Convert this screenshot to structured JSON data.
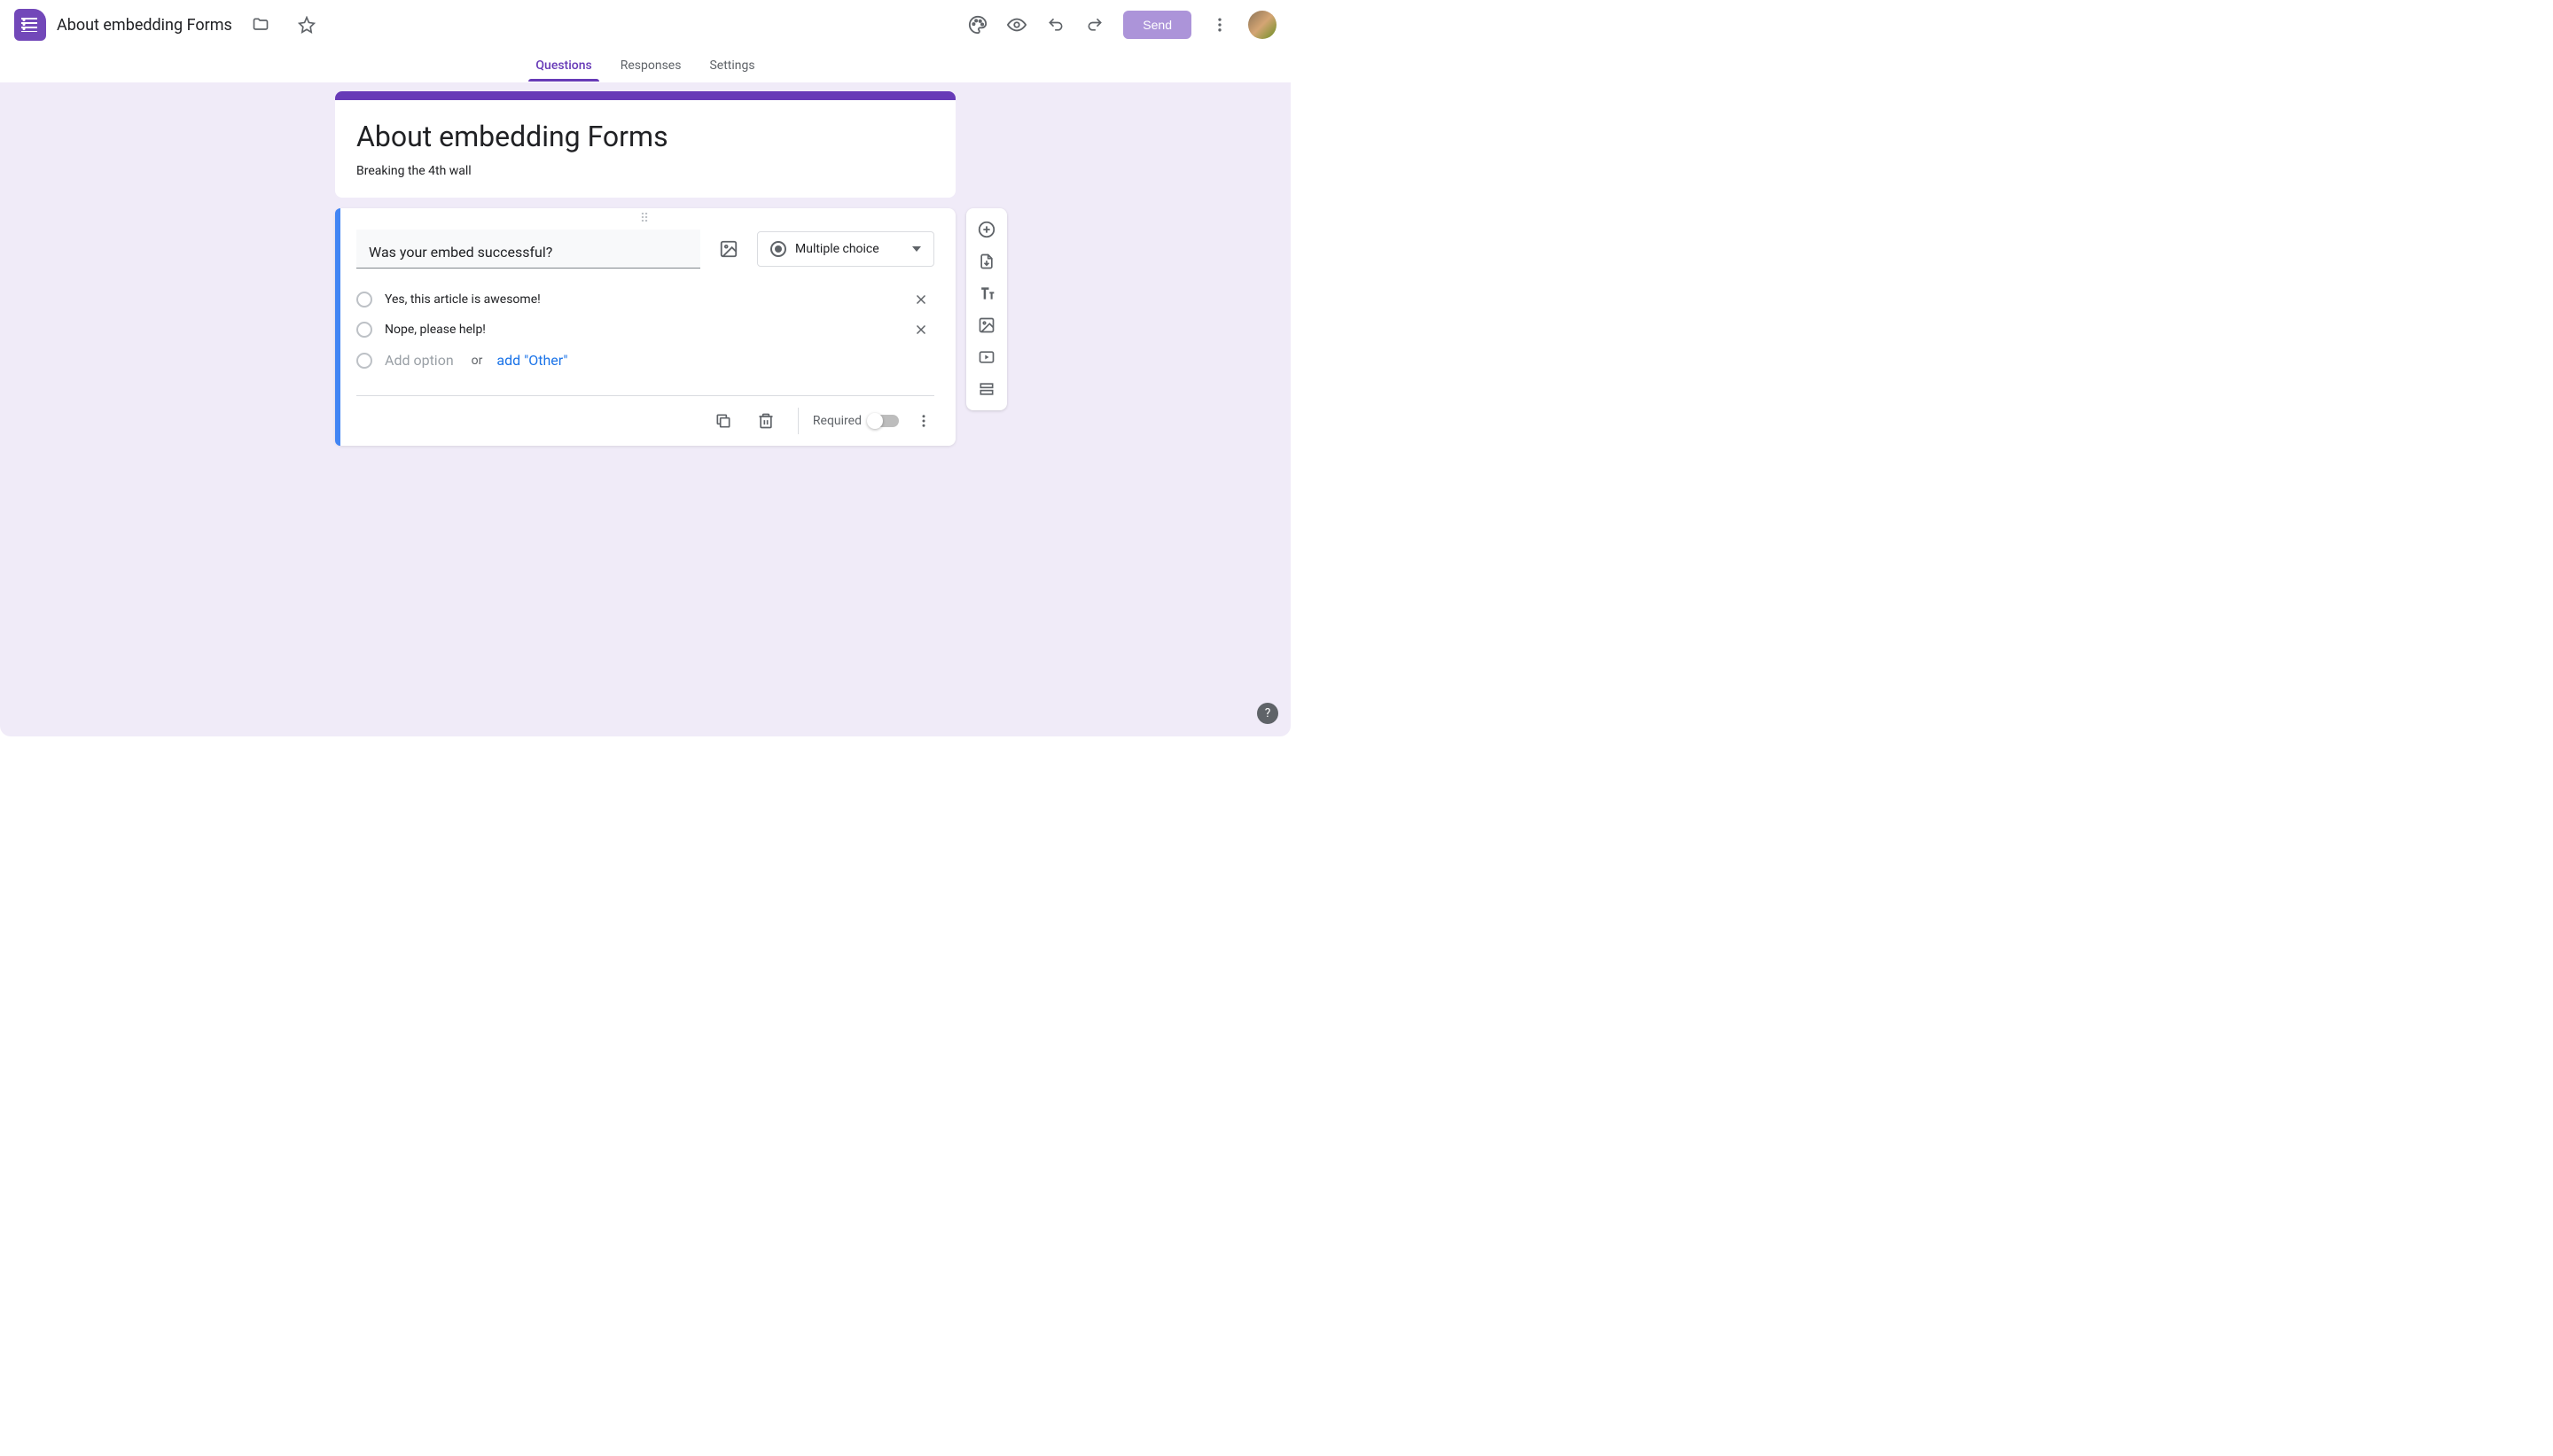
{
  "header": {
    "doc_title": "About embedding Forms",
    "send_label": "Send"
  },
  "tabs": {
    "questions": "Questions",
    "responses": "Responses",
    "settings": "Settings"
  },
  "form": {
    "title": "About embedding Forms",
    "description": "Breaking the 4th wall"
  },
  "question": {
    "text": "Was your embed successful?",
    "type_label": "Multiple choice",
    "options": [
      "Yes, this article is awesome!",
      "Nope, please help!"
    ],
    "add_option_placeholder": "Add option",
    "or_label": "or",
    "add_other_label": "add \"Other\"",
    "required_label": "Required"
  }
}
